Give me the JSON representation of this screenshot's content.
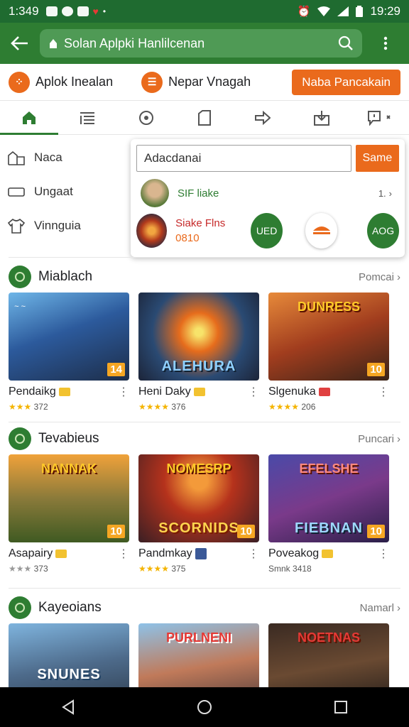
{
  "status_bar": {
    "time_left": "1:349",
    "time_right": "19:29"
  },
  "appbar": {
    "search_text": "Solan Aplpki Hanlilcenan"
  },
  "chips": {
    "item1": "Aplok Inealan",
    "item2": "Nepar Vnagah",
    "button": "Naba Pancakain"
  },
  "tabs": [
    "home-icon",
    "list-icon",
    "game-icon",
    "file-icon",
    "share-icon",
    "install-icon",
    "chat-icon"
  ],
  "drawer": {
    "items": [
      "Naca",
      "Ungaat",
      "Vinnguia"
    ]
  },
  "popup": {
    "input_value": "Adacdanai",
    "button": "Same",
    "row1_name": "SIF liake",
    "row1_value": "1.",
    "row2_name": "Siake Flns",
    "row2_value": "0810",
    "btn_left": "UED",
    "btn_right": "AOG"
  },
  "sections": [
    {
      "title": "Miablach",
      "more": "Pomcai",
      "cards": [
        {
          "name": "Pendaikg",
          "rating": "372",
          "badge": "14",
          "art_top": "",
          "art_bottom": ""
        },
        {
          "name": "Heni Daky",
          "rating": "376",
          "badge": "",
          "art_top": "",
          "art_bottom": "ALEHURA"
        },
        {
          "name": "Slgenuka",
          "rating": "206",
          "badge": "10",
          "art_top": "DUNRESS",
          "art_bottom": ""
        }
      ]
    },
    {
      "title": "Tevabieus",
      "more": "Puncari",
      "cards": [
        {
          "name": "Asapairy",
          "rating": "373",
          "badge": "10",
          "art_top": "NANNAK",
          "art_bottom": ""
        },
        {
          "name": "Pandmkay",
          "rating": "375",
          "badge": "10",
          "art_top": "NOMESRP",
          "art_bottom": "SCORNIDS"
        },
        {
          "name": "Poveakog",
          "rating": "3418",
          "rating_prefix": "Smnk",
          "badge": "10",
          "art_top": "EFELSHE",
          "art_bottom": "FIEBNAN"
        }
      ]
    },
    {
      "title": "Kayeoians",
      "more": "Namarl",
      "cards": [
        {
          "name": "",
          "rating": "",
          "badge": "",
          "art_top": "",
          "art_bottom": "SNUNES"
        },
        {
          "name": "",
          "rating": "",
          "badge": "",
          "art_top": "PURLNENI",
          "art_bottom": ""
        },
        {
          "name": "",
          "rating": "",
          "badge": "",
          "art_top": "NOETNAS",
          "art_bottom": ""
        }
      ]
    }
  ],
  "colors": {
    "primary": "#2e7d32",
    "accent": "#ea6a1c",
    "star": "#f4b400"
  }
}
